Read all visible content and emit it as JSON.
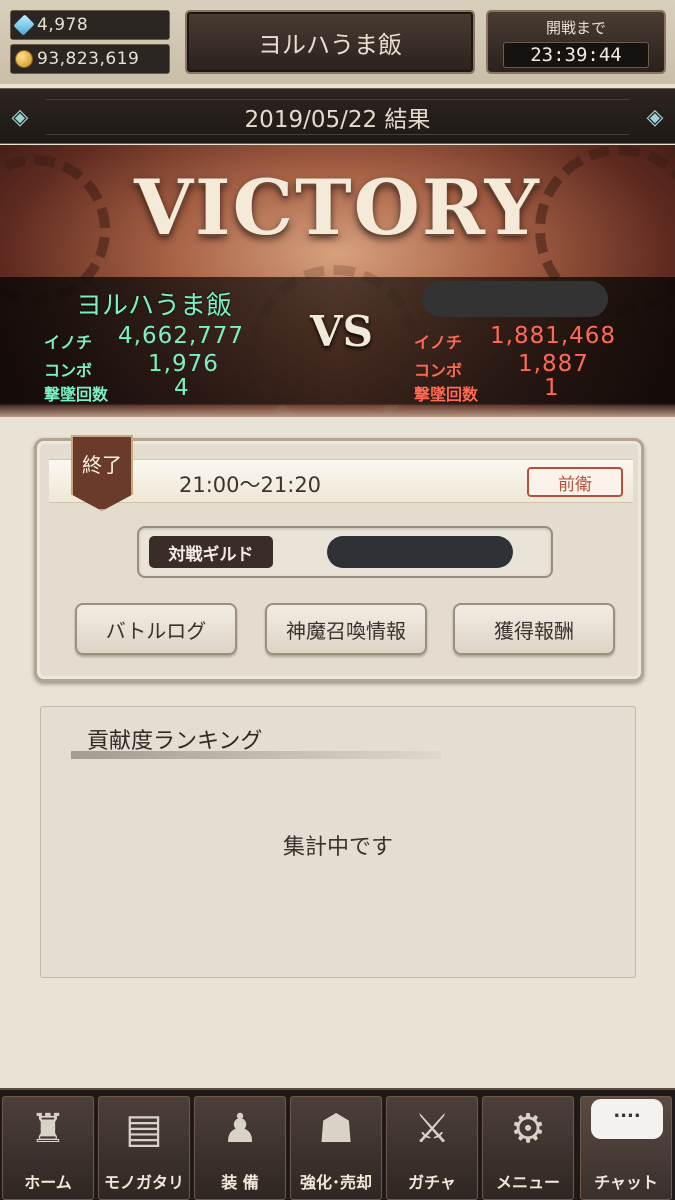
{
  "currency": {
    "crystals": "4,978",
    "gold": "93,823,619"
  },
  "header": {
    "guild_name": "ヨルハうま飯",
    "battle_start_label": "開戦まで",
    "battle_start_time": "23:39:44"
  },
  "result_bar": {
    "title": "2019/05/22 結果"
  },
  "banner": {
    "headline": "VICTORY",
    "vs_label": "VS",
    "our_team": {
      "name": "ヨルハうま飯",
      "life_label": "イノチ",
      "life_value": "4,662,777",
      "combo_label": "コンボ",
      "combo_value": "1,976",
      "kills_label": "撃墜回数",
      "kills_value": "4"
    },
    "enemy_team": {
      "life_label": "イノチ",
      "life_value": "1,881,468",
      "combo_label": "コンボ",
      "combo_value": "1,887",
      "kills_label": "撃墜回数",
      "kills_value": "1"
    }
  },
  "battle_card": {
    "status_badge": "終了",
    "time_range": "21:00〜21:20",
    "position": "前衛",
    "opponent_label": "対戦ギルド",
    "buttons": {
      "battle_log": "バトルログ",
      "summon_info": "神魔召喚情報",
      "rewards": "獲得報酬"
    }
  },
  "ranking": {
    "title": "貢献度ランキング",
    "status": "集計中です"
  },
  "bottom_nav": {
    "items": [
      {
        "label": "ホーム",
        "icon": "castle-icon"
      },
      {
        "label": "モノガタリ",
        "icon": "book-icon"
      },
      {
        "label": "装 備",
        "icon": "puppet-icon"
      },
      {
        "label": "強化･売却",
        "icon": "mask-icon"
      },
      {
        "label": "ガチャ",
        "icon": "crossed-swords-icon"
      },
      {
        "label": "メニュー",
        "icon": "gears-icon"
      },
      {
        "label": "チャット",
        "icon": "chat-bubble-icon",
        "bubble": "...."
      }
    ]
  }
}
